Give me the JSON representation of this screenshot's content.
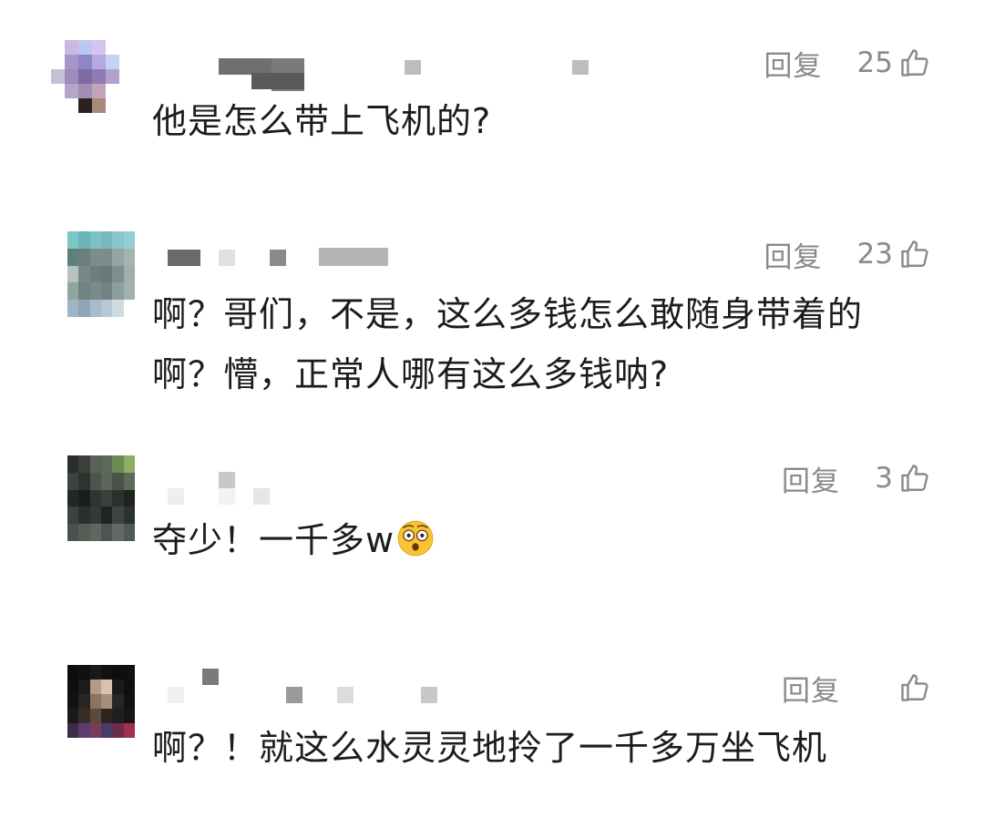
{
  "comments": [
    {
      "reply_label": "回复",
      "likes": "25",
      "text": "他是怎么带上飞机的?"
    },
    {
      "reply_label": "回复",
      "likes": "23",
      "text": "啊？哥们，不是，这么多钱怎么敢随身带着的啊？懵，正常人哪有这么多钱呐?"
    },
    {
      "reply_label": "回复",
      "likes": "3",
      "text": "夺少！一千多w",
      "emoji": "astonished-face-emoji"
    },
    {
      "reply_label": "回复",
      "likes": "",
      "text": "啊？！就这么水灵灵地拎了一千多万坐飞机"
    }
  ],
  "colors": {
    "text": "#1c1c1c",
    "meta": "#8a8a8a",
    "background": "#ffffff"
  },
  "icons": {
    "like": "thumbs-up-icon"
  }
}
